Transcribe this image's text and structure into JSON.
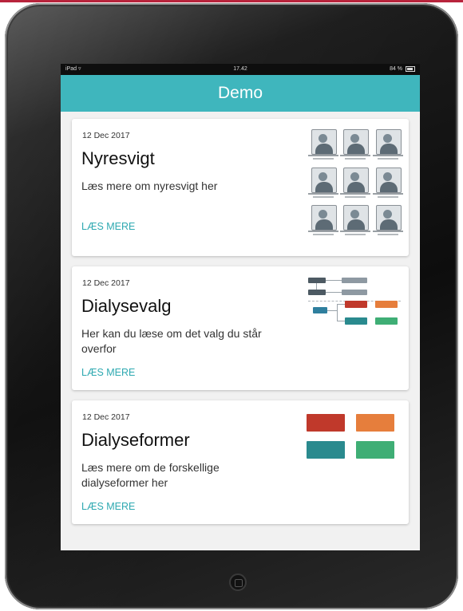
{
  "statusbar": {
    "device": "iPad",
    "wifi_icon": "wifi-icon",
    "time": "17.42",
    "battery": "84 %",
    "battery_icon": "battery-icon"
  },
  "appbar": {
    "title": "Demo"
  },
  "cards": [
    {
      "date": "12 Dec 2017",
      "title": "Nyresvigt",
      "description": "Læs mere om nyresvigt her",
      "link": "LÆS MERE",
      "thumbnail": "illustration-grid"
    },
    {
      "date": "12 Dec 2017",
      "title": "Dialysevalg",
      "description": "Her kan du læse om det valg du står overfor",
      "link": "LÆS MERE",
      "thumbnail": "flow-diagram"
    },
    {
      "date": "12 Dec 2017",
      "title": "Dialyseformer",
      "description": "Læs mere om de forskellige dialyseformer her",
      "link": "LÆS MERE",
      "thumbnail": "treatment-boxes"
    }
  ],
  "colors": {
    "accent": "#3fb6bd",
    "link": "#2ea9b1",
    "box_red": "#c0392b",
    "box_orange": "#e67e3c",
    "box_teal": "#2a8a8e",
    "box_green": "#3fae75"
  }
}
